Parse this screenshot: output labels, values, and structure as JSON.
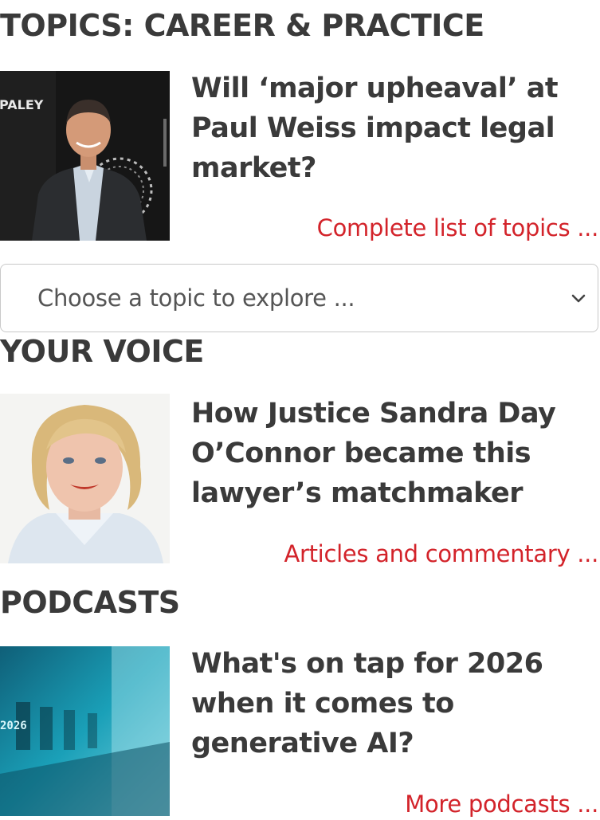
{
  "sections": {
    "topics": {
      "title": "TOPICS: CAREER & PRACTICE",
      "headline": "Will ‘major upheaval’ at Paul Weiss impact legal market?",
      "link": "Complete list of topics ...",
      "select_value": "Choose a topic to explore ..."
    },
    "voice": {
      "title": "YOUR VOICE",
      "headline": "How Justice Sandra Day O’Connor became this lawyer’s matchmaker",
      "link": "Articles and commentary ..."
    },
    "podcasts": {
      "title": "PODCASTS",
      "headline": "What's on tap for 2026 when it comes to generative AI?",
      "link": "More podcasts ..."
    }
  },
  "thumbnails": {
    "topics_photo_text": "PALEY",
    "podcast_photo_text": "2026"
  },
  "colors": {
    "link": "#d3232a",
    "heading": "#3a3a3a",
    "border": "#c9c9c9"
  },
  "icons": {
    "select": "chevron-down-icon"
  }
}
